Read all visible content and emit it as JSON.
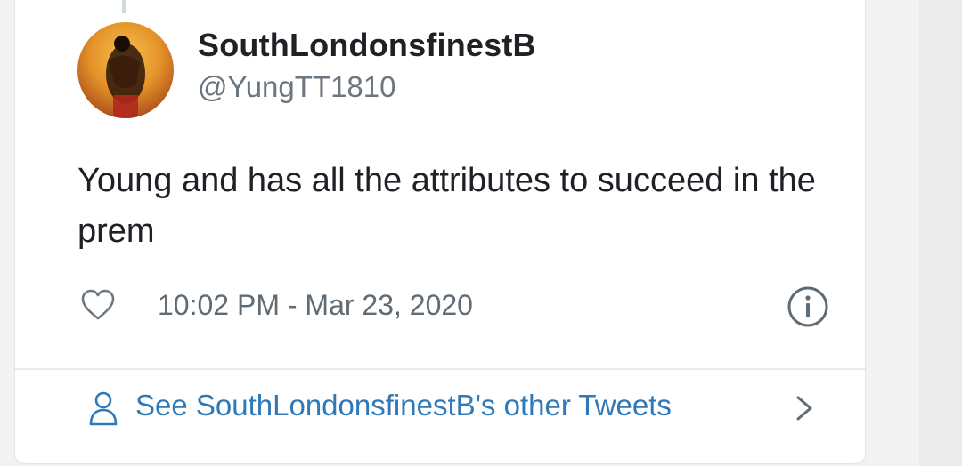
{
  "tweet": {
    "display_name": "SouthLondonsfinestB",
    "handle": "@YungTT1810",
    "text": "Young and has all the attributes to succeed in the prem",
    "timestamp": "10:02 PM - Mar 23, 2020"
  },
  "footer": {
    "other_tweets_label": "See SouthLondonsfinestB's other Tweets"
  },
  "icons": {
    "like": "heart-icon",
    "info": "info-icon",
    "profile": "person-icon",
    "navigate": "chevron-right-icon"
  },
  "colors": {
    "link": "#2f79b8",
    "text_primary": "#1e2126",
    "text_secondary": "#5f6b75",
    "icon": "#6b7680"
  }
}
